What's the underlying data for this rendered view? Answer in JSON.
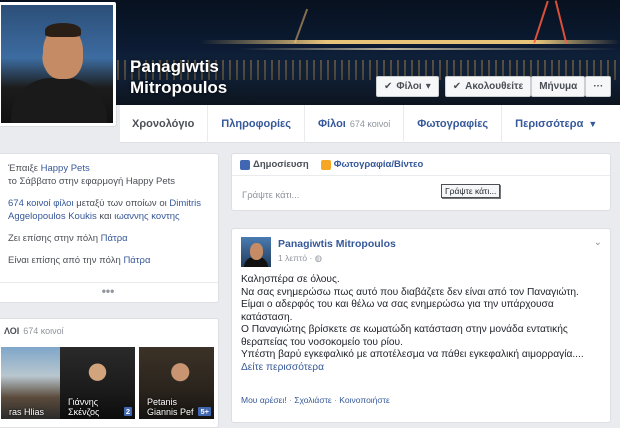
{
  "profile": {
    "name_line1": "Panagiwtis",
    "name_line2": "Mitropoulos"
  },
  "actions": {
    "friends_label": "Φίλοι",
    "follow_label": "Ακολουθείτε",
    "message_label": "Μήνυμα",
    "more_label": "···"
  },
  "nav": {
    "timeline": "Χρονολόγιο",
    "about": "Πληροφορίες",
    "friends": "Φίλοι",
    "friends_count": "674 κοινοί",
    "photos": "Φωτογραφίες",
    "more": "Περισσότερα"
  },
  "intro": {
    "played_prefix": "Έπαιξε ",
    "played_game": "Happy Pets",
    "played_when": "το Σάββατο στην εφαρμογή Happy Pets",
    "mutual_count": "674 κοινοί φίλοι",
    "mutual_text": " μεταξύ των οποίων οι ",
    "mutual_names": "Dimitris Aggelopoulos Koukis",
    "mutual_and": " και ",
    "mutual_name2": "ιωαννης κοντης",
    "lives_prefix": "Ζει επίσης στην πόλη ",
    "lives_city": "Πάτρα",
    "from_prefix": "Είναι επίσης από την πόλη ",
    "from_city": "Πάτρα",
    "more_dots": "•••"
  },
  "friends_box": {
    "title": "ΛΟΙ",
    "count": "674 κοινοί",
    "items": [
      {
        "name_line1": "",
        "name_line2": "ras Hlias",
        "count": "5+"
      },
      {
        "name_line1": "Γιάννης",
        "name_line2": "Σκένζος",
        "count": "2"
      },
      {
        "name_line1": "Petanis",
        "name_line2": "Giannis Pef",
        "count": "5+"
      }
    ]
  },
  "composer": {
    "status_label": "Δημοσίευση",
    "photo_label": "Φωτογραφία/Βίντεο",
    "placeholder": "Γράψτε κάτι...",
    "tooltip": "Γράψτε κάτι..."
  },
  "post": {
    "author": "Panagiwtis Mitropoulos",
    "time": "1 λεπτό · ",
    "line1": "Καλησπέρα σε όλους.",
    "line2": "Να σας ενημερώσω πως αυτό που διαβάζετε δεν είναι από τον Παναγιώτη.",
    "line3": "Είμαι ο αδερφός του και θέλω να σας ενημερώσω για την υπάρχουσα κατάσταση.",
    "line4": "Ο Παναγιώτης βρίσκετε σε κωματώδη κατάσταση στην μονάδα εντατικής θεραπείας του νοσοκομείο του ρίου.",
    "line5": "Υπέστη βαρύ εγκεφαλικό με αποτέλεσμα να πάθει εγκεφαλική αιμορραγία....",
    "see_more": "Δείτε περισσότερα",
    "like": "Μου αρέσει!",
    "comment": "Σχολιάστε",
    "share": "Κοινοποιήστε",
    "sep": " · "
  }
}
